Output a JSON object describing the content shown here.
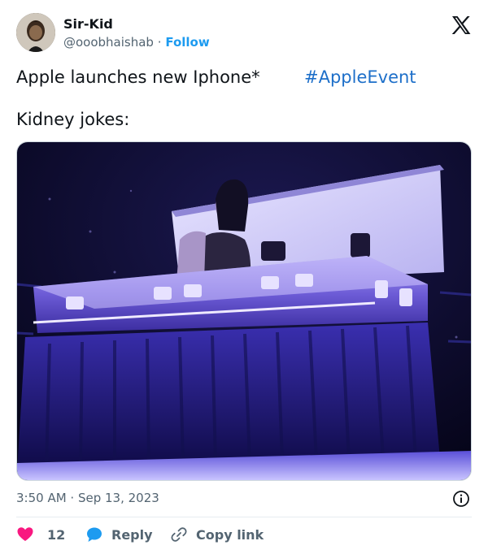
{
  "author": {
    "display_name": "Sir-Kid",
    "handle": "@ooobhaishab",
    "separator": "·",
    "follow_label": "Follow"
  },
  "tweet": {
    "text_line1": "Apple launches new Iphone*",
    "hashtag": "#AppleEvent",
    "text_line2": "Kidney jokes:"
  },
  "meta": {
    "timestamp": "3:50 AM · Sep 13, 2023"
  },
  "actions": {
    "like_count": "12",
    "reply_label": "Reply",
    "copy_link_label": "Copy link"
  },
  "colors": {
    "accent": "#1d9bf0",
    "like": "#f91880",
    "muted": "#536471",
    "text": "#0f1419"
  },
  "icons": {
    "logo": "x-logo-icon",
    "info": "info-icon",
    "like": "heart-icon",
    "reply": "speech-bubble-icon",
    "copy": "link-icon"
  }
}
